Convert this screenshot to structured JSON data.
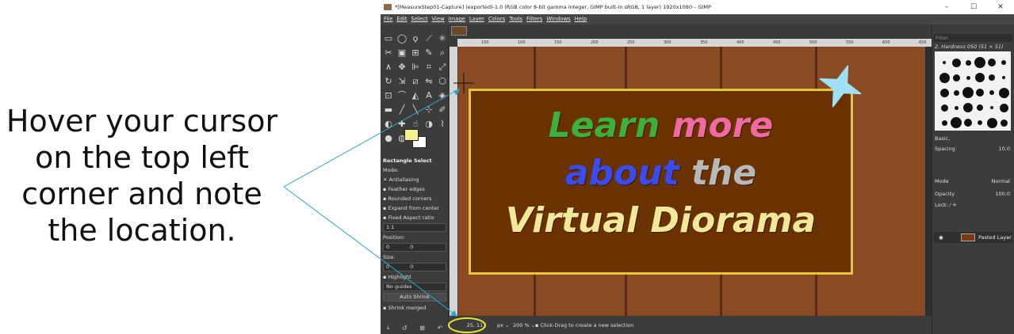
{
  "instruction": {
    "lines": [
      "Hover your cursor",
      "on the top left",
      "corner and note",
      "the location."
    ]
  },
  "window": {
    "title": "*[MeasureStep01-Capture] (exported)-1.0 (RGB color 8-bit gamma integer, GIMP built-in sRGB, 1 layer) 1920x1080 – GIMP",
    "minimize": "–",
    "maximize": "☐",
    "close": "✕"
  },
  "menu": [
    "File",
    "Edit",
    "Select",
    "View",
    "Image",
    "Layer",
    "Colors",
    "Tools",
    "Filters",
    "Windows",
    "Help"
  ],
  "tool_options": {
    "title": "Rectangle Select",
    "mode_label": "Mode:",
    "antialiasing": "Antialiasing",
    "feather": "Feather edges",
    "rounded": "Rounded corners",
    "expand": "Expand from center",
    "fixed": "Fixed",
    "fixed_value": "Aspect ratio",
    "ratio": "1:1",
    "position_label": "Position:",
    "position_unit": "px",
    "position_x": "0",
    "position_y": "0",
    "size_label": "Size:",
    "size_unit": "px",
    "size_w": "0",
    "size_h": "0",
    "highlight": "Highlight",
    "guides": "No guides",
    "auto_shrink": "Auto Shrink",
    "shrink_merged": "Shrink merged"
  },
  "ruler_ticks": [
    "150",
    "100",
    "150",
    "200",
    "250",
    "300",
    "350",
    "400",
    "450",
    "500",
    "550",
    "600",
    "650"
  ],
  "canvas_text": {
    "line1a": "Learn",
    "line1b": "more",
    "line2a": "about",
    "line2b": "the",
    "line3": "Virtual Diorama"
  },
  "status": {
    "coords": "25, 113",
    "unit": "px",
    "zoom": "200 %",
    "hint": "Click-Drag to create a new selection"
  },
  "docks": {
    "filter_placeholder": "Filter",
    "brush_name": "2. Hardness 050 (51 × 51)",
    "preset": "Basic,",
    "spacing_label": "Spacing",
    "spacing_value": "10.0",
    "mode_label": "Mode",
    "mode_value": "Normal",
    "opacity_label": "Opacity",
    "opacity_value": "100.0",
    "lock_label": "Lock:",
    "layer_name": "Pasted Layer"
  },
  "colors": {
    "foreground": "#f6f08c",
    "background": "#ffffff",
    "annotation_line": "#2aa7c9",
    "highlight_circle": "#f0e52a"
  }
}
